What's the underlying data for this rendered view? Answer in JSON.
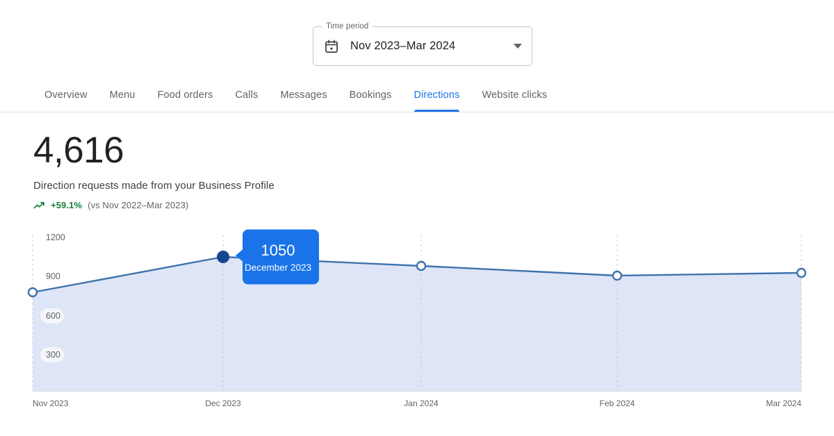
{
  "time_period": {
    "legend": "Time period",
    "value": "Nov 2023–Mar 2024",
    "icon": "calendar-icon",
    "caret": "chevron-down-icon"
  },
  "tabs": [
    {
      "label": "Overview",
      "active": false
    },
    {
      "label": "Menu",
      "active": false
    },
    {
      "label": "Food orders",
      "active": false
    },
    {
      "label": "Calls",
      "active": false
    },
    {
      "label": "Messages",
      "active": false
    },
    {
      "label": "Bookings",
      "active": false
    },
    {
      "label": "Directions",
      "active": true
    },
    {
      "label": "Website clicks",
      "active": false
    }
  ],
  "summary": {
    "total": "4,616",
    "description": "Direction requests made from your Business Profile",
    "delta": "+59.1%",
    "delta_icon": "trending-up-icon",
    "comparison": "(vs Nov 2022–Mar 2023)"
  },
  "colors": {
    "accent": "#1a73e8",
    "line": "#4285c5",
    "area_fill": "#dde5f7",
    "positive": "#188038",
    "tooltip_bg": "#1a73e8",
    "marker_active": "#174ea6",
    "text_muted": "#5f6368"
  },
  "tooltip": {
    "value": "1050",
    "label": "December 2023"
  },
  "chart_data": {
    "type": "area",
    "title": "Direction requests made from your Business Profile",
    "xlabel": "",
    "ylabel": "",
    "categories": [
      "Nov 2023",
      "Dec 2023",
      "Jan 2024",
      "Feb 2024",
      "Mar 2024"
    ],
    "values": [
      780,
      1050,
      980,
      900,
      920
    ],
    "yticks": [
      300,
      600,
      900,
      1200
    ],
    "ylim": [
      0,
      1270
    ],
    "grid": "vertical-dashed",
    "legend": "none",
    "highlighted_point": {
      "category": "December 2023",
      "value": 1050
    },
    "annotations": [
      {
        "type": "tooltip",
        "at": "Dec 2023",
        "value": "1050",
        "label": "December 2023"
      }
    ]
  }
}
